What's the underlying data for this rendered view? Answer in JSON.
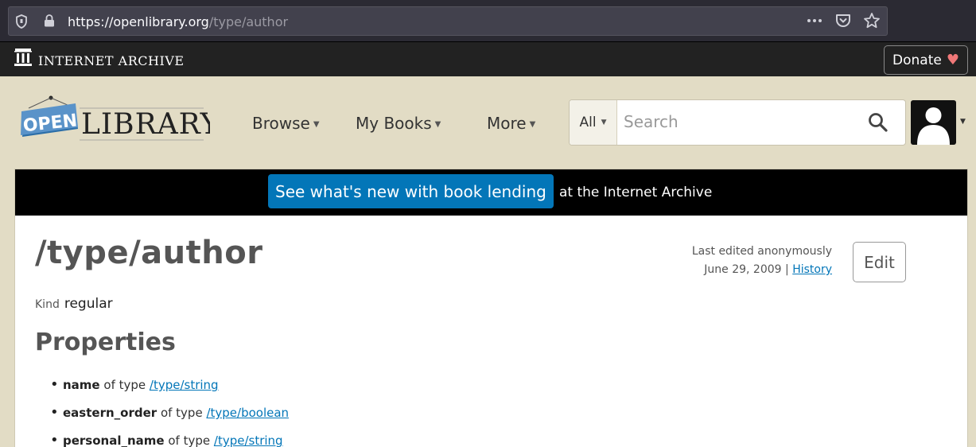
{
  "browser": {
    "url_host": "https://openlibrary.org",
    "url_path": "/type/author"
  },
  "ia_bar": {
    "name": "INTERNET ARCHIVE",
    "donate_label": "Donate",
    "donate_heart": "♥"
  },
  "header": {
    "logo_open": "OPEN",
    "logo_library": "LIBRARY",
    "nav": [
      {
        "label": "Browse"
      },
      {
        "label": "My Books"
      },
      {
        "label": "More"
      }
    ],
    "search": {
      "scope": "All",
      "placeholder": "Search"
    }
  },
  "banner": {
    "link_label": "See what's new with book lending",
    "suffix": "at the Internet Archive"
  },
  "page": {
    "title": "/type/author",
    "edited_line": "Last edited anonymously",
    "edited_date": "June 29, 2009",
    "separator": "|",
    "history_label": "History",
    "edit_label": "Edit",
    "kind_label": "Kind",
    "kind_value": "regular",
    "properties_heading": "Properties",
    "of_type": "of type",
    "properties": [
      {
        "name": "name",
        "type": "/type/string"
      },
      {
        "name": "eastern_order",
        "type": "/type/boolean"
      },
      {
        "name": "personal_name",
        "type": "/type/string"
      }
    ]
  },
  "colors": {
    "page_bg": "#e2dcc5",
    "link": "#0376b8",
    "banner_bg": "#000000",
    "ia_bar_bg": "#222222"
  }
}
